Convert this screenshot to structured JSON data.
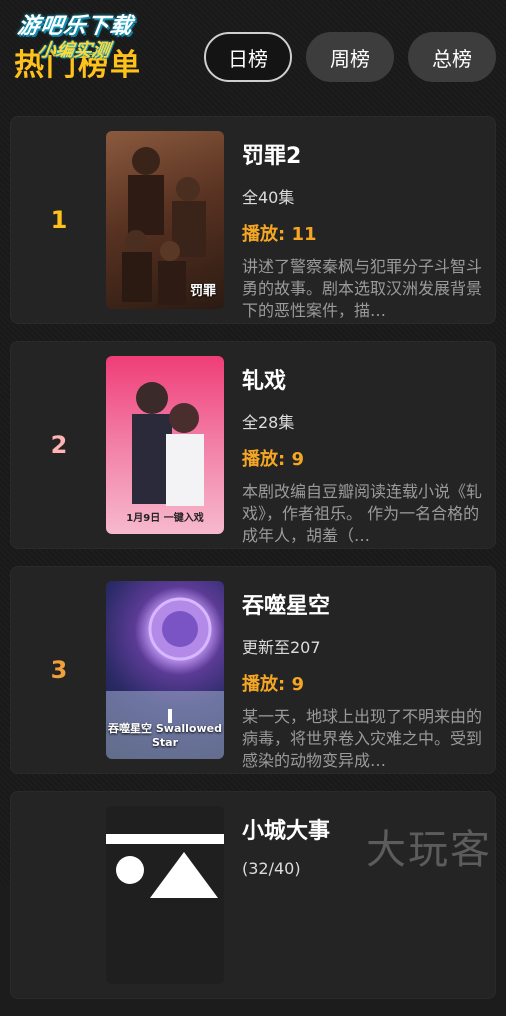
{
  "watermark": {
    "top": "游吧乐下载",
    "sub": "小编实测",
    "bottom": "大玩客"
  },
  "header": {
    "title": "热门榜单"
  },
  "tabs": [
    {
      "label": "日榜",
      "active": true
    },
    {
      "label": "周榜",
      "active": false
    },
    {
      "label": "总榜",
      "active": false
    }
  ],
  "items": [
    {
      "rank": "1",
      "rank_color": "#ffc21a",
      "title": "罚罪2",
      "episodes": "全40集",
      "plays": "播放: 11",
      "description": "讲述了警察秦枫与犯罪分子斗智斗勇的故事。剧本选取汉洲发展背景下的恶性案件，描…",
      "poster_text": "罚罪"
    },
    {
      "rank": "2",
      "rank_color": "#ffb3b3",
      "title": "轧戏",
      "episodes": "全28集",
      "plays": "播放: 9",
      "description": "本剧改编自豆瓣阅读连载小说《轧戏》，作者祖乐。 作为一名合格的成年人，胡羞（…",
      "poster_text": "1月9日 一键入戏"
    },
    {
      "rank": "3",
      "rank_color": "#f0a03a",
      "title": "吞噬星空",
      "episodes": "更新至207",
      "plays": "播放: 9",
      "description": "某一天，地球上出现了不明来由的病毒，将世界卷入灾难之中。受到感染的动物变异成…",
      "poster_text": "吞噬星空 Swallowed Star"
    },
    {
      "rank": "",
      "rank_color": "#ffffff",
      "title": "小城大事",
      "episodes": "(32/40)",
      "plays": "",
      "description": "",
      "poster_text": ""
    }
  ]
}
